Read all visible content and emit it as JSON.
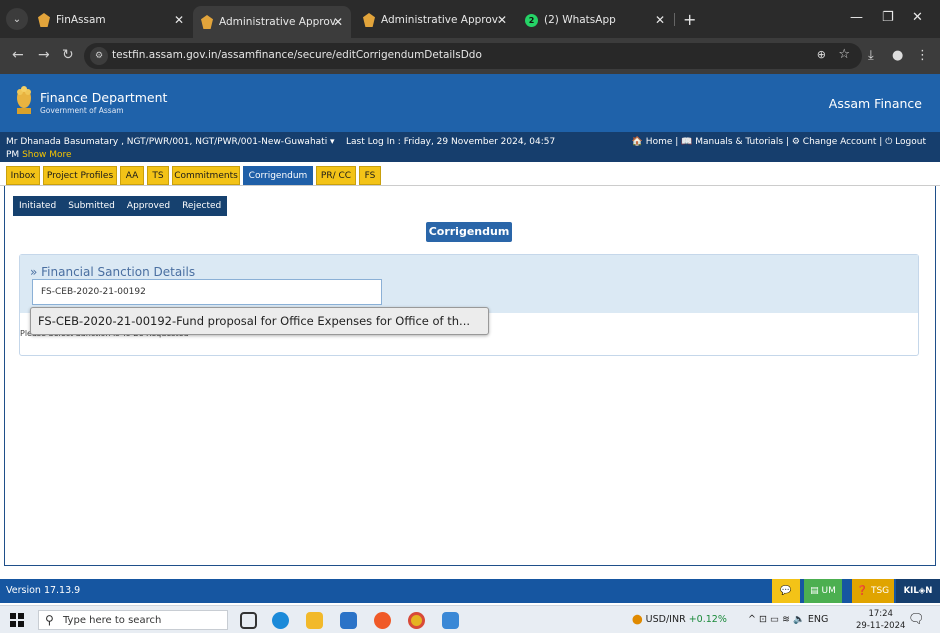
{
  "browser": {
    "tabs": [
      {
        "label": "FinAssam",
        "active": false
      },
      {
        "label": "Administrative Approval, Techni",
        "active": true
      },
      {
        "label": "Administrative Approval, Techn",
        "active": false
      },
      {
        "label": "(2) WhatsApp",
        "active": false
      }
    ],
    "url": "testfin.assam.gov.in/assamfinance/secure/editCorrigendumDetailsDdo"
  },
  "header": {
    "dept_title": "Finance Department",
    "dept_sub": "Government of Assam",
    "app_name": "Assam Finance"
  },
  "userbar": {
    "user": "Mr Dhanada Basumatary , NGT/PWR/001, NGT/PWR/001-New-Guwahati ▾",
    "last_login": "Last Log In : Friday, 29 November 2024, 04:57",
    "last_login_cont": "PM",
    "show_more": "Show More",
    "links": "🏠 Home | 📖 Manuals & Tutorials | ⚙ Change Account | ⏻ Logout"
  },
  "menu": [
    {
      "label": "Inbox",
      "active": false
    },
    {
      "label": "Project Profiles",
      "active": false
    },
    {
      "label": "AA",
      "active": false
    },
    {
      "label": "TS",
      "active": false
    },
    {
      "label": "Commitments",
      "active": false
    },
    {
      "label": "Corrigendum",
      "active": true
    },
    {
      "label": "PR/ CC",
      "active": false
    },
    {
      "label": "FS",
      "active": false
    }
  ],
  "subtabs": [
    "Initiated",
    "Submitted",
    "Approved",
    "Rejected"
  ],
  "page": {
    "title": "Corrigendum",
    "panel_title": "» Financial Sanction Details",
    "input_value": "FS-CEB-2020-21-00192",
    "hint": "Please Select Sanction Is To Be Requested",
    "suggestion": "FS-CEB-2020-21-00192-Fund proposal for Office Expenses for Office of th..."
  },
  "footer": {
    "version": "Version 17.13.9",
    "um": "UM",
    "tsg": "TSG",
    "logo": "KIL◈N"
  },
  "taskbar": {
    "search_placeholder": "Type here to search",
    "currency": "USD/INR",
    "currency_change": "+0.12%",
    "lang": "ENG",
    "time": "17:24",
    "date": "29-11-2024"
  },
  "colors": {
    "header_blue": "#1f62aa",
    "userbar_navy": "#163e6d",
    "menu_yellow": "#f3c317",
    "active_blue": "#1f5fa8"
  }
}
